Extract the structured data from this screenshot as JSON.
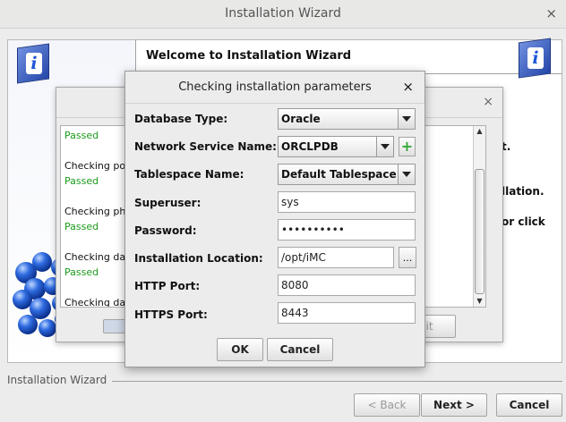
{
  "window": {
    "title": "Installation Wizard",
    "close_glyph": "×"
  },
  "welcome": {
    "title": "Welcome to Installation Wizard",
    "partial_lines": [
      "t.",
      "llation.",
      "or click"
    ]
  },
  "footer": {
    "separator_label": "Installation Wizard",
    "back_label": "< Back",
    "next_label": "Next >",
    "cancel_label": "Cancel"
  },
  "progress_dialog": {
    "close_glyph": "×",
    "exit_partial": "xit",
    "log_lines": [
      {
        "text": "Passed",
        "status": "pass"
      },
      {
        "text": "Checking port",
        "status": "info"
      },
      {
        "text": "Passed",
        "status": "pass"
      },
      {
        "text": "Checking phy",
        "status": "info"
      },
      {
        "text": "Passed",
        "status": "pass"
      },
      {
        "text": "Checking data",
        "status": "info"
      },
      {
        "text": "Passed",
        "status": "pass"
      },
      {
        "text": "Checking data",
        "status": "info"
      }
    ]
  },
  "modal": {
    "title": "Checking installation parameters",
    "close_glyph": "×",
    "fields": {
      "db_type": {
        "label": "Database Type:",
        "value": "Oracle"
      },
      "network_service": {
        "label": "Network Service Name:",
        "value": "ORCLPDB"
      },
      "tablespace": {
        "label": "Tablespace Name:",
        "value": "Default Tablespace"
      },
      "superuser": {
        "label": "Superuser:",
        "value": "sys"
      },
      "password": {
        "label": "Password:",
        "value": "••••••••••"
      },
      "install_location": {
        "label": "Installation Location:",
        "value": "/opt/iMC",
        "browse_label": "..."
      },
      "http_port": {
        "label": "HTTP Port:",
        "value": "8080"
      },
      "https_port": {
        "label": "HTTPS Port:",
        "value": "8443"
      }
    },
    "add_glyph": "+",
    "ok_label": "OK",
    "cancel_label": "Cancel"
  },
  "colors": {
    "pass": "#1b9a1b",
    "molecule": "#1e5fd6"
  }
}
